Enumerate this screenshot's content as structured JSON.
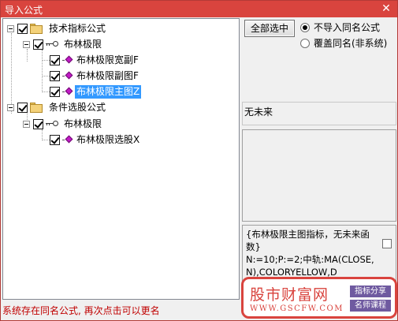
{
  "window": {
    "title": "导入公式",
    "close_glyph": "✕"
  },
  "tree": {
    "groups": [
      {
        "label": "技术指标公式",
        "checked": true,
        "children": [
          {
            "label": "布林极限",
            "checked": true,
            "items": [
              {
                "label": "布林极限宽副F",
                "checked": true,
                "selected": false
              },
              {
                "label": "布林极限副图F",
                "checked": true,
                "selected": false
              },
              {
                "label": "布林极限主图Z",
                "checked": true,
                "selected": true
              }
            ]
          }
        ]
      },
      {
        "label": "条件选股公式",
        "checked": true,
        "children": [
          {
            "label": "布林极限",
            "checked": true,
            "items": [
              {
                "label": "布林极限选股X",
                "checked": true,
                "selected": false
              }
            ]
          }
        ]
      }
    ]
  },
  "buttons": {
    "select_all": "全部选中"
  },
  "options": {
    "no_import_same": {
      "label": "不导入同名公式",
      "checked": true
    },
    "overwrite_same": {
      "label": "覆盖同名(非系统)",
      "checked": false
    }
  },
  "future_status": "无未来",
  "description": "{布林极限主图指标，无未来函数}\nN:=10;P:=2;中轨:MA(CLOSE,N),COLORYELLOW,D",
  "status_message": "系统存在同名公式, 再次点击可以更名",
  "watermark": {
    "site_name": "股市财富网",
    "url": "WWW.GSCFW.COM",
    "tag1": "指标分享",
    "tag2": "名师课程",
    "accent": "#d9443e",
    "tag_color": "#6f5aa0"
  },
  "colors": {
    "titlebar": "#d9443e",
    "selection": "#3399ff",
    "status_text": "#c00000"
  }
}
